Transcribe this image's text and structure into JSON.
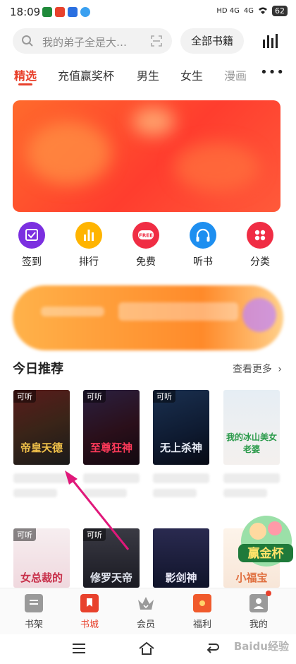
{
  "status_bar": {
    "time": "18:09",
    "network1": "HD 4G",
    "network2": "4G",
    "battery": "62"
  },
  "search": {
    "placeholder": "我的弟子全是大…",
    "all_books": "全部书籍"
  },
  "tabs": [
    {
      "label": "精选",
      "active": true
    },
    {
      "label": "充值赢奖杯"
    },
    {
      "label": "男生"
    },
    {
      "label": "女生"
    },
    {
      "label": "漫画"
    }
  ],
  "quick_actions": [
    {
      "label": "签到",
      "color": "#7b2fe0",
      "icon": "calendar-check-icon"
    },
    {
      "label": "排行",
      "color": "#ffb400",
      "icon": "bar-chart-icon"
    },
    {
      "label": "免费",
      "color": "#f02d44",
      "icon": "free-icon",
      "icon_text": "FREE"
    },
    {
      "label": "听书",
      "color": "#1e8ff0",
      "icon": "headphones-icon"
    },
    {
      "label": "分类",
      "color": "#f02d44",
      "icon": "grid-icon"
    }
  ],
  "section": {
    "title": "今日推荐",
    "more": "查看更多"
  },
  "books_row1": [
    {
      "badge": "可听",
      "title": "帝皇天德",
      "bg": "#3a2418",
      "fg": "#f2c24a"
    },
    {
      "badge": "可听",
      "title": "至尊狂神",
      "bg": "#2a0f1a",
      "fg": "#ff3a5a"
    },
    {
      "badge": "可听",
      "title": "无上杀神",
      "bg": "#0e1a30",
      "fg": "#e9eef8"
    },
    {
      "badge": "",
      "title": "我的冰山美女老婆",
      "bg": "#e9eef2",
      "fg": "#2a9a4a"
    }
  ],
  "books_row2": [
    {
      "badge": "可听",
      "title": "女总裁的",
      "bg": "#f3e6e8",
      "fg": "#c8304a"
    },
    {
      "badge": "可听",
      "title": "修罗天帝",
      "bg": "#1a1a22",
      "fg": "#e0e4ee"
    },
    {
      "badge": "",
      "title": "影剑神",
      "bg": "#10142a",
      "fg": "#e8e8f6"
    },
    {
      "badge": "",
      "title": "小福宝",
      "bg": "#fdf4ea",
      "fg": "#e07040"
    }
  ],
  "float_badge": {
    "label": "赢金杯"
  },
  "bottom_tabs": [
    {
      "label": "书架",
      "icon": "bookshelf-icon"
    },
    {
      "label": "书城",
      "icon": "bookstore-icon",
      "active": true
    },
    {
      "label": "会员",
      "icon": "vip-crown-icon"
    },
    {
      "label": "福利",
      "icon": "gift-icon"
    },
    {
      "label": "我的",
      "icon": "profile-icon"
    }
  ],
  "watermark": "Baidu经验"
}
